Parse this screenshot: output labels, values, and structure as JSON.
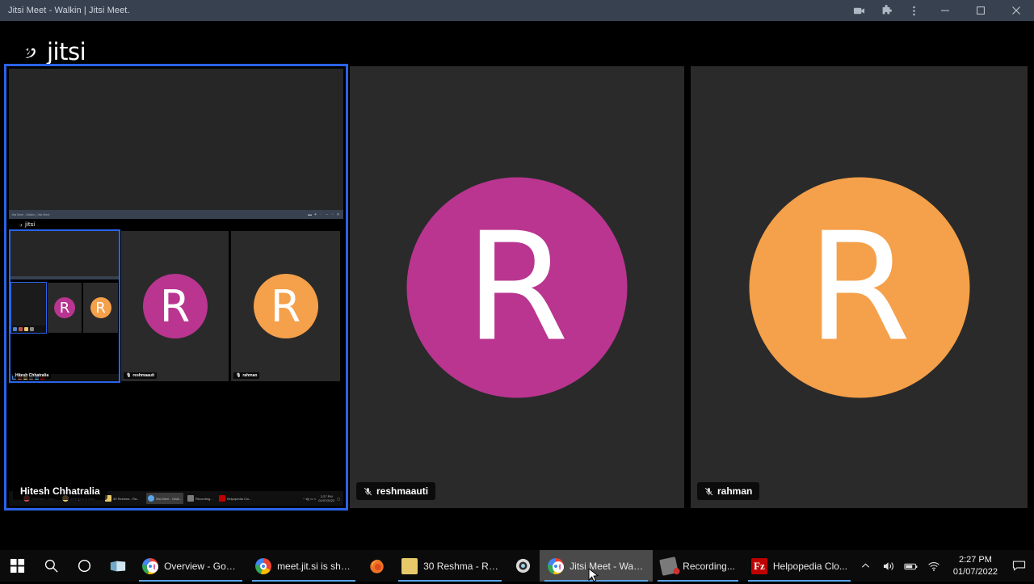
{
  "window": {
    "title": "Jitsi Meet - Walkin | Jitsi Meet.",
    "controls": {
      "cast": "cast-icon",
      "extensions": "puzzle-icon",
      "menu": "three-dot-menu-icon",
      "minimize": "minimize-icon",
      "maximize": "maximize-icon",
      "close": "close-icon"
    }
  },
  "app": {
    "brand": "jitsi",
    "participants": [
      {
        "name": "Hitesh Chhatralia",
        "muted": false,
        "kind": "screenshare",
        "active": true,
        "avatar_letter": "",
        "avatar_color": ""
      },
      {
        "name": "reshmaauti",
        "muted": true,
        "kind": "avatar",
        "active": false,
        "avatar_letter": "R",
        "avatar_color": "#b93590"
      },
      {
        "name": "rahman",
        "muted": true,
        "kind": "avatar",
        "active": false,
        "avatar_letter": "R",
        "avatar_color": "#f5a04a"
      }
    ],
    "active_border_color": "#2a63e8"
  },
  "nested": {
    "title": "Jitsi Meet - Walkin | Jitsi Meet.",
    "brand": "jitsi",
    "participants": [
      {
        "name": "Hitesh Chhatralia",
        "muted": false
      },
      {
        "name": "reshmaauti",
        "muted": true
      },
      {
        "name": "rahman",
        "muted": true
      }
    ],
    "avatar_letter": "R",
    "taskbar": [
      {
        "label": "Overview - Goo...",
        "icon": "chrome-icon",
        "active": false
      },
      {
        "label": "meet.jit.si is shar...",
        "icon": "chrome-icon",
        "active": false
      },
      {
        "label": "30 Reshma - Ra...",
        "icon": "folder-icon",
        "active": false
      },
      {
        "label": "Jitsi Meet - Walk...",
        "icon": "chrome-icon",
        "active": true
      },
      {
        "label": "Recording...",
        "icon": "recorder-icon",
        "active": false
      },
      {
        "label": "Helpopedia Clo...",
        "icon": "filezilla-icon",
        "active": false
      }
    ],
    "clock_time": "2:27 PM",
    "clock_date": "01/07/2022"
  },
  "taskbar": {
    "start": "windows-start-icon",
    "search": "search-icon",
    "cortana": "cortana-icon",
    "explorer": "file-explorer-icon",
    "tasks": [
      {
        "label": "Overview - Goo...",
        "icon": "chrome-icon",
        "active": false,
        "running": true
      },
      {
        "label": "meet.jit.si is shar...",
        "icon": "chrome-icon",
        "active": false,
        "running": true
      },
      {
        "label": "30 Reshma - Ra...",
        "icon": "folder-icon",
        "active": false,
        "running": true
      },
      {
        "label": "Jitsi Meet - Walk...",
        "icon": "chrome-icon",
        "active": true,
        "running": true
      },
      {
        "label": "Recording...",
        "icon": "recorder-icon",
        "active": false,
        "running": true
      },
      {
        "label": "Helpopedia Clo...",
        "icon": "filezilla-icon",
        "active": false,
        "running": true
      }
    ],
    "firefox_label": "firefox-icon",
    "camera_label": "camera-app-icon",
    "tray": {
      "chevron": "show-hidden-icons-icon",
      "volume": "volume-icon",
      "battery": "battery-icon",
      "network": "wifi-icon",
      "time": "2:27 PM",
      "date": "01/07/2022",
      "action_center": "notifications-icon"
    }
  }
}
